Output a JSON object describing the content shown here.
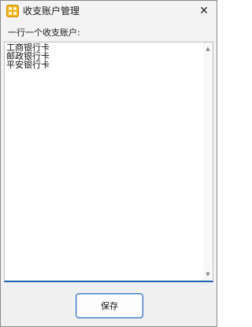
{
  "window": {
    "title": "收支账户管理",
    "close_glyph": "✕",
    "icon": "app-icon"
  },
  "form": {
    "label": "一行一个收支账户:",
    "accounts_text": "工商银行卡\n邮政银行卡\n平安银行卡"
  },
  "scrollbar": {
    "up_glyph": "▲",
    "down_glyph": "▼"
  },
  "footer": {
    "save_label": "保存"
  },
  "colors": {
    "accent": "#1f5fb0",
    "button_border": "#2f6fc4",
    "icon": "#f4b41c"
  }
}
